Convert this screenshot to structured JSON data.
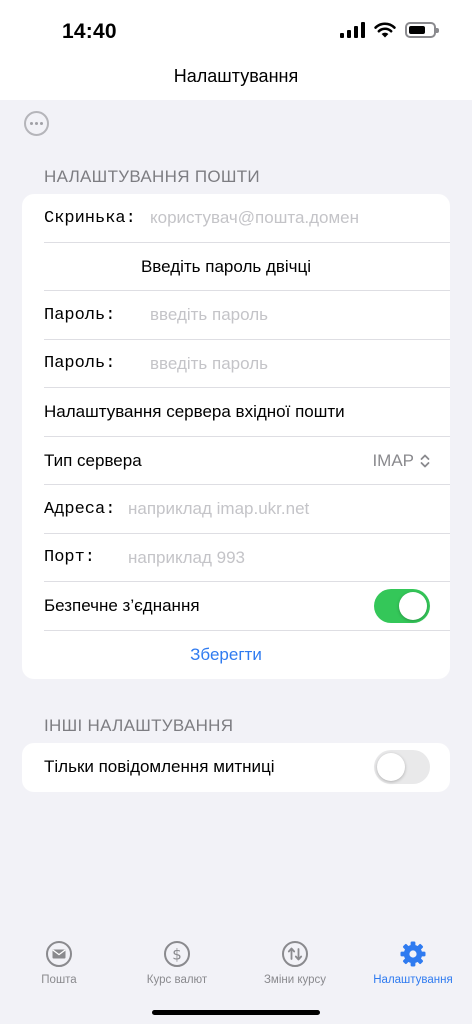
{
  "status_bar": {
    "time": "14:40"
  },
  "nav": {
    "title": "Налаштування"
  },
  "mail_settings": {
    "header": "НАЛАШТУВАННЯ ПОШТИ",
    "mailbox_label": "Скринька:",
    "mailbox_placeholder": "користувач@пошта.домен",
    "password_hint": "Введіть пароль двічці",
    "password_label": "Пароль:",
    "password_placeholder": "введіть пароль",
    "password2_label": "Пароль:",
    "password2_placeholder": "введіть пароль",
    "incoming_server_title": "Налаштування сервера вхідної пошти",
    "server_type_label": "Тип сервера",
    "server_type_value": "IMAP",
    "address_label": "Адреса:",
    "address_placeholder": "наприклад imap.ukr.net",
    "port_label": "Порт:",
    "port_placeholder": "наприклад 993",
    "secure_label": "Безпечне з’єднання",
    "secure_enabled": true,
    "save_label": "Зберегти"
  },
  "other_settings": {
    "header": "ІНШІ НАЛАШТУВАННЯ",
    "customs_only_label": "Тільки повідомлення митниці",
    "customs_only_enabled": false
  },
  "tabs": [
    {
      "label": "Пошта",
      "icon": "envelope-icon",
      "active": false
    },
    {
      "label": "Курс валют",
      "icon": "dollar-icon",
      "active": false
    },
    {
      "label": "Зміни курсу",
      "icon": "arrows-updown-icon",
      "active": false
    },
    {
      "label": "Налаштування",
      "icon": "gear-icon",
      "active": true
    }
  ],
  "colors": {
    "accent": "#2f7bf0",
    "toggle_on": "#34c759",
    "background": "#f2f2f7"
  }
}
